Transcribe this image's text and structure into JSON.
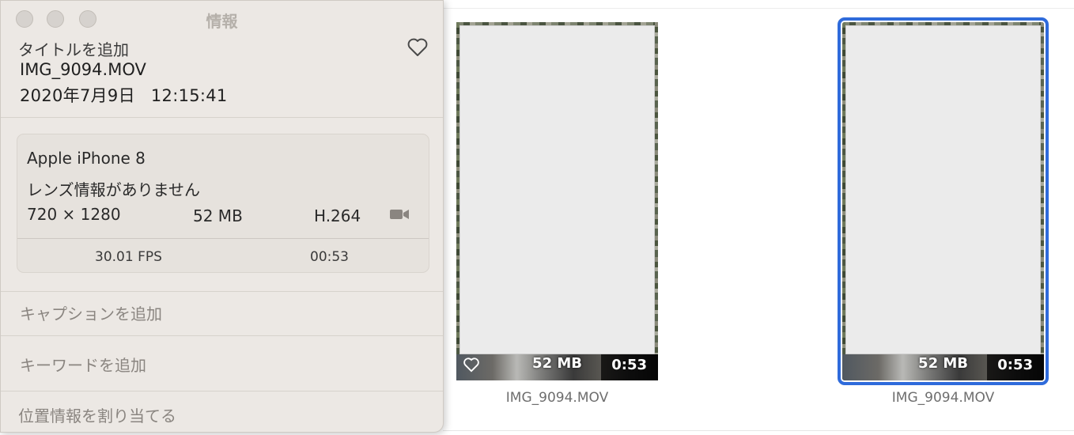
{
  "window": {
    "title": "情報"
  },
  "info": {
    "add_title": "タイトルを追加",
    "filename": "IMG_9094.MOV",
    "date": "2020年7月9日",
    "time": "12:15:41"
  },
  "meta": {
    "device": "Apple iPhone 8",
    "lens": "レンズ情報がありません",
    "dimensions": "720 × 1280",
    "size": "52 MB",
    "codec": "H.264",
    "fps": "30.01 FPS",
    "duration": "00:53"
  },
  "actions": {
    "add_caption": "キャプションを追加",
    "add_keyword": "キーワードを追加",
    "assign_location": "位置情報を割り当てる"
  },
  "grid": {
    "items": [
      {
        "filename": "IMG_9094.MOV",
        "size": "52 MB",
        "duration": "0:53",
        "selected": false
      },
      {
        "filename": "IMG_9094.MOV",
        "size": "52 MB",
        "duration": "0:53",
        "selected": true
      }
    ]
  },
  "colors": {
    "selection": "#2f6bdb",
    "panel_bg": "#ece8e4"
  },
  "icons": [
    "heart-icon",
    "video-camera-icon"
  ]
}
